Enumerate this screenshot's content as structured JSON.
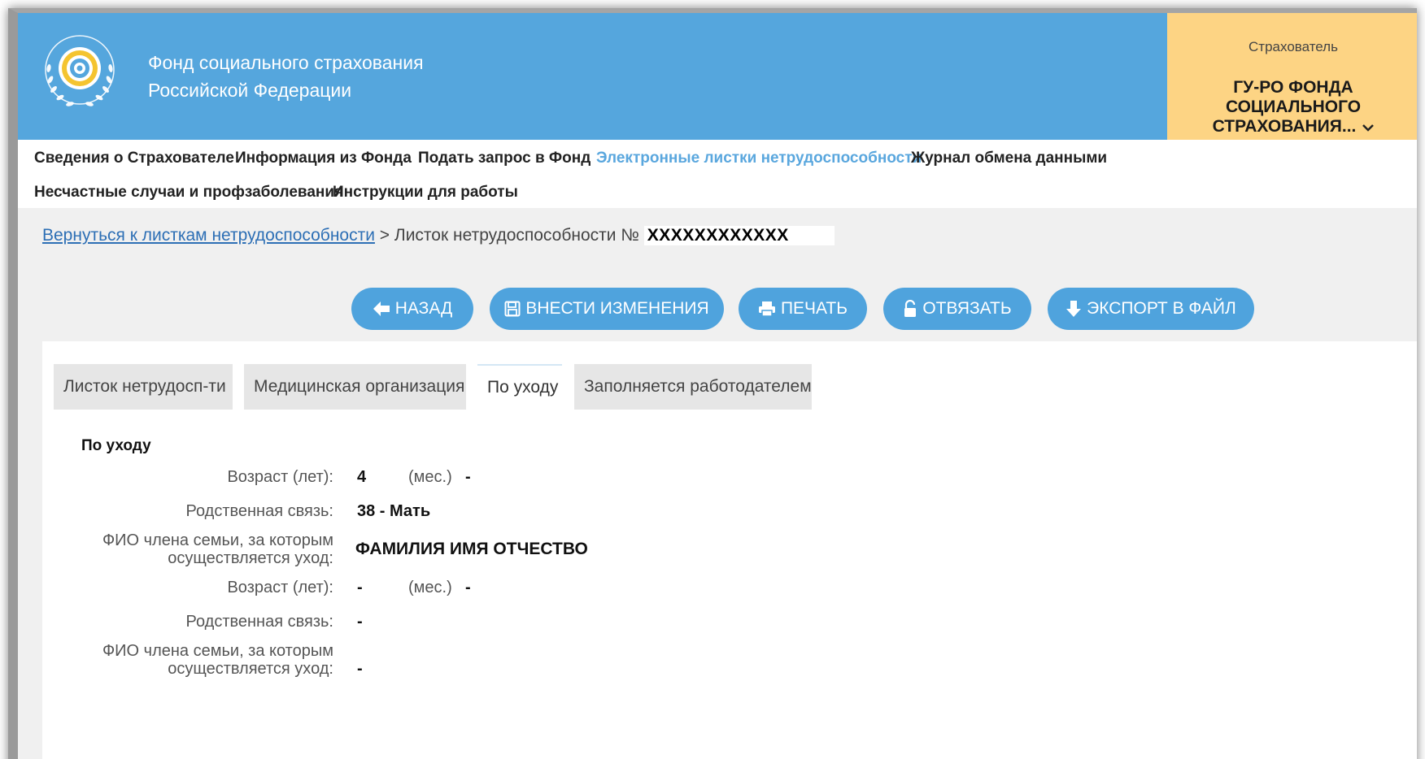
{
  "header": {
    "org_line1": "Фонд социального страхования",
    "org_line2": "Российской Федерации",
    "insurer_caption": "Страхователь",
    "insurer_name_line1": "ГУ-РО ФОНДА",
    "insurer_name_line2": "СОЦИАЛЬНОГО",
    "insurer_name_line3": "СТРАХОВАНИЯ...",
    "colors": {
      "header_bg": "#55a6dd",
      "insurer_bg": "#fdd484"
    }
  },
  "nav": {
    "items": [
      {
        "label": "Сведения о Страхователе"
      },
      {
        "label": "Информация из Фонда"
      },
      {
        "label": "Подать запрос в Фонд"
      },
      {
        "label": "Электронные листки нетрудоспособности",
        "active": true
      },
      {
        "label": "Журнал обмена данными"
      },
      {
        "label": "Несчастные случаи и профзаболевания"
      },
      {
        "label": "Инструкции для работы"
      }
    ]
  },
  "breadcrumb": {
    "back_link": "Вернуться к листкам нетрудоспособности",
    "separator": ">",
    "current": "Листок нетрудоспособности №",
    "number": "XXXXXXXXXXXX"
  },
  "actions": {
    "back": "НАЗАД",
    "save": "ВНЕСТИ ИЗМЕНЕНИЯ",
    "print": "ПЕЧАТЬ",
    "unlink": "ОТВЯЗАТЬ",
    "export": "ЭКСПОРТ В ФАЙЛ",
    "icons": [
      "arrow-left-icon",
      "floppy-disk-icon",
      "printer-icon",
      "unlock-icon",
      "arrow-down-icon"
    ]
  },
  "tabs": [
    {
      "label": "Листок нетрудосп-ти"
    },
    {
      "label": "Медицинская организация"
    },
    {
      "label": "По уходу",
      "active": true
    },
    {
      "label": "Заполняется работодателем"
    }
  ],
  "care": {
    "section_title": "По уходу",
    "labels": {
      "age_years": "Возраст (лет):",
      "age_months": "(мес.)",
      "relation": "Родственная связь:",
      "fio_line1": "ФИО члена семьи, за которым",
      "fio_line2": "осуществляется уход:"
    },
    "persons": [
      {
        "age_years": "4",
        "age_months": "-",
        "relation": "38 - Мать",
        "fio": "ФАМИЛИЯ ИМЯ ОТЧЕСТВО"
      },
      {
        "age_years": "-",
        "age_months": "-",
        "relation": "-",
        "fio": "-"
      }
    ]
  }
}
